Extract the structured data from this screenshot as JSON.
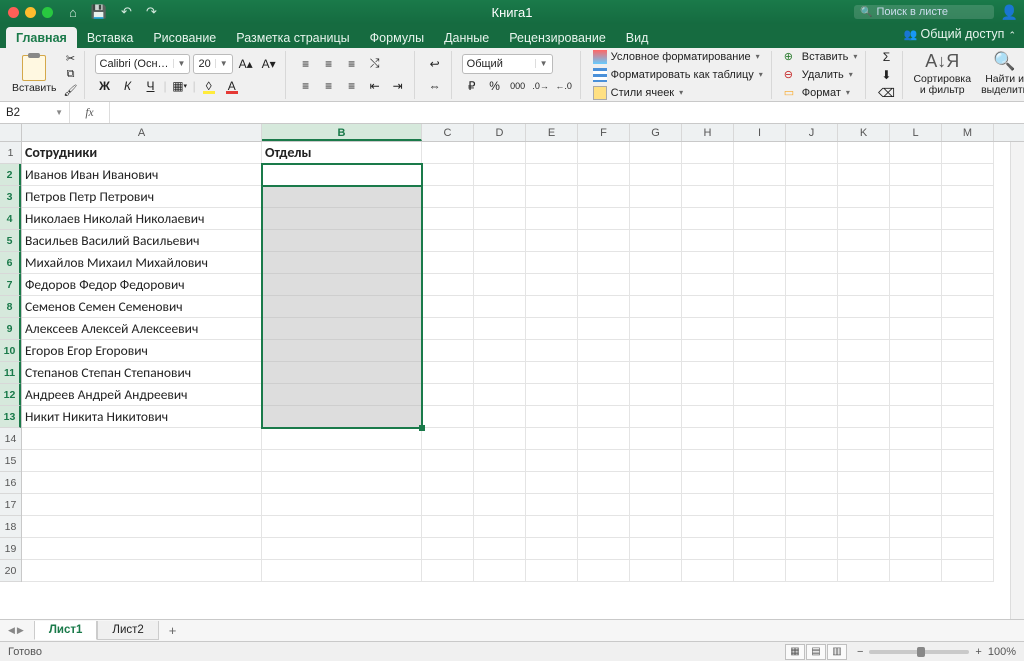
{
  "window": {
    "title": "Книга1",
    "search_placeholder": "Поиск в листе"
  },
  "tabs": {
    "items": [
      "Главная",
      "Вставка",
      "Рисование",
      "Разметка страницы",
      "Формулы",
      "Данные",
      "Рецензирование",
      "Вид"
    ],
    "active": 0,
    "share": "Общий доступ"
  },
  "ribbon": {
    "paste": "Вставить",
    "font_name": "Calibri (Осн…",
    "font_size": "20",
    "bold": "Ж",
    "italic": "К",
    "underline": "Ч",
    "num_format": "Общий",
    "styles": {
      "conditional": "Условное форматирование",
      "as_table": "Форматировать как таблицу",
      "cell_styles": "Стили ячеек"
    },
    "cells": {
      "insert": "Вставить",
      "delete": "Удалить",
      "format": "Формат"
    },
    "sort": "Сортировка\nи фильтр",
    "find": "Найти и\nвыделить"
  },
  "fx": {
    "namebox": "B2",
    "formula": ""
  },
  "grid": {
    "col_widths": {
      "A": 240,
      "B": 160,
      "other": 52
    },
    "columns": [
      "A",
      "B",
      "C",
      "D",
      "E",
      "F",
      "G",
      "H",
      "I",
      "J",
      "K",
      "L",
      "M"
    ],
    "rows": 20,
    "selection": {
      "col": "B",
      "row_from": 2,
      "row_to": 13
    },
    "data": {
      "A1": "Сотрудники",
      "B1": "Отделы",
      "A2": "Иванов Иван Иванович",
      "A3": "Петров Петр Петрович",
      "A4": "Николаев Николай Николаевич",
      "A5": "Васильев Василий Васильевич",
      "A6": "Михайлов Михаил Михайлович",
      "A7": "Федоров Федор Федорович",
      "A8": "Семенов Семен Семенович",
      "A9": "Алексеев Алексей Алексеевич",
      "A10": "Егоров Егор Егорович",
      "A11": "Степанов Степан Степанович",
      "A12": "Андреев Андрей Андреевич",
      "A13": "Никит Никита Никитович"
    }
  },
  "sheets": {
    "tabs": [
      "Лист1",
      "Лист2"
    ],
    "active": 0
  },
  "status": {
    "ready": "Готово",
    "zoom": "100%"
  }
}
